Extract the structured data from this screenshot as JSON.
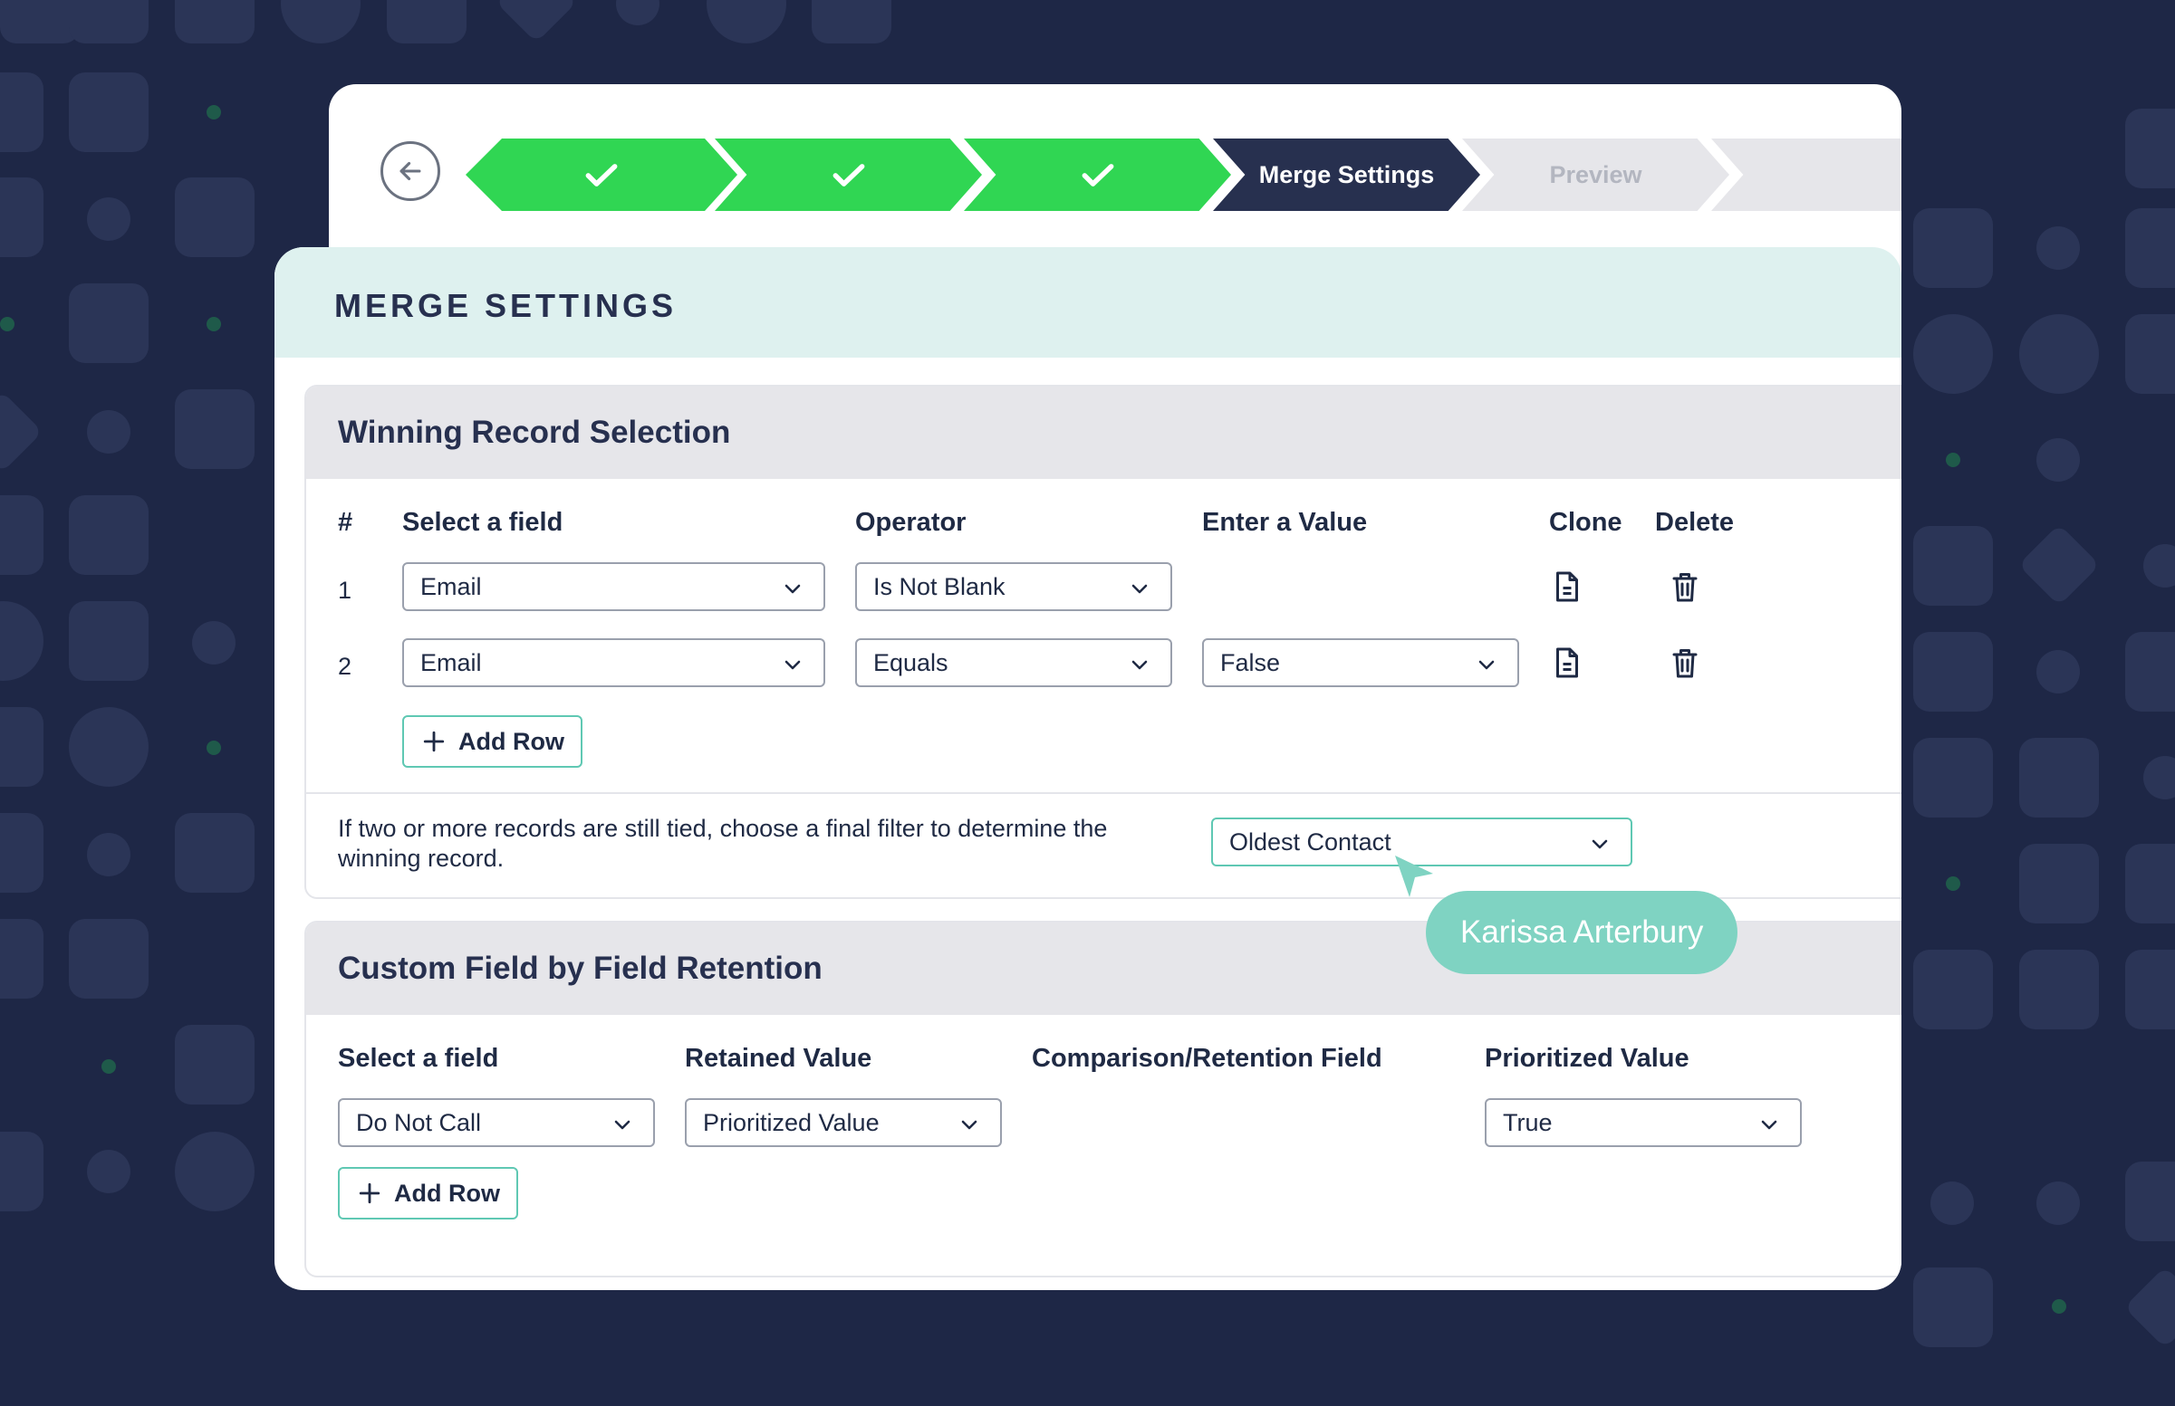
{
  "colors": {
    "background": "#1e2746",
    "step_done": "#30d653",
    "step_active": "#27304f",
    "step_pending": "#e6e6ea",
    "header_band": "#def1ef",
    "accent_teal": "#5fc8b3",
    "user_tag": "#7fd3c2"
  },
  "stepper": {
    "steps": [
      {
        "label": "",
        "state": "done",
        "icon": "check-icon"
      },
      {
        "label": "",
        "state": "done",
        "icon": "check-icon"
      },
      {
        "label": "",
        "state": "done",
        "icon": "check-icon"
      },
      {
        "label": "Merge Settings",
        "state": "active"
      },
      {
        "label": "Preview",
        "state": "pending"
      },
      {
        "label": "",
        "state": "pending"
      }
    ]
  },
  "page": {
    "title": "MERGE SETTINGS"
  },
  "winning": {
    "title": "Winning Record Selection",
    "columns": {
      "num": "#",
      "field": "Select a field",
      "operator": "Operator",
      "value": "Enter a Value",
      "clone": "Clone",
      "delete": "Delete"
    },
    "rows": [
      {
        "num": "1",
        "field": "Email",
        "operator": "Is Not Blank",
        "value": ""
      },
      {
        "num": "2",
        "field": "Email",
        "operator": "Equals",
        "value": "False"
      }
    ],
    "add_row_label": "Add Row",
    "tie_text": "If two or more records are still tied, choose a final filter to determine the winning record.",
    "tie_select": "Oldest Contact"
  },
  "custom": {
    "title": "Custom Field by Field Retention",
    "columns": {
      "field": "Select a field",
      "retained": "Retained Value",
      "comparison": "Comparison/Retention Field",
      "prioritized": "Prioritized Value"
    },
    "rows": [
      {
        "field": "Do Not Call",
        "retained": "Prioritized Value",
        "comparison": "",
        "prioritized": "True"
      }
    ],
    "add_row_label": "Add Row"
  },
  "collaborator": {
    "name": "Karissa Arterbury"
  }
}
